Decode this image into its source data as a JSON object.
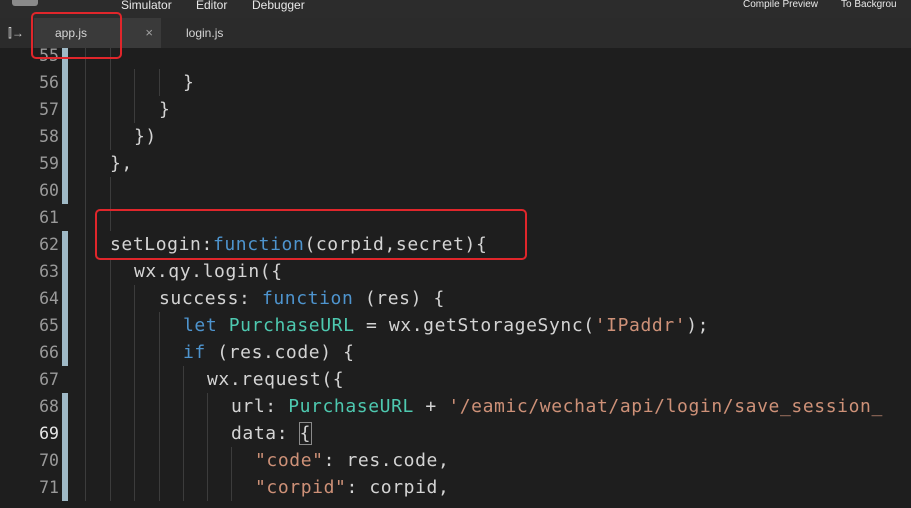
{
  "menubar": {
    "items": [
      "Simulator",
      "Editor",
      "Debugger"
    ],
    "right_items": [
      "Compile Preview",
      "To Backgrou"
    ]
  },
  "tabs": [
    {
      "label": "app.js",
      "close": "×",
      "active": true
    },
    {
      "label": "login.js",
      "active": false
    }
  ],
  "sidebar_toggle_icon": "⫿→",
  "colors": {
    "accent_highlight": "#e0262b",
    "keyword": "#4e94ce",
    "type": "#4ec9b0",
    "string": "#ce9178",
    "line_marker": "#9fb9c6"
  },
  "editor": {
    "current_line": 69,
    "lines": [
      {
        "num": "55",
        "segments": [
          {
            "t": ""
          }
        ]
      },
      {
        "num": "56",
        "segments": [
          {
            "t": "}"
          }
        ]
      },
      {
        "num": "57",
        "segments": [
          {
            "t": "}"
          }
        ]
      },
      {
        "num": "58",
        "segments": [
          {
            "t": "})"
          }
        ]
      },
      {
        "num": "59",
        "segments": [
          {
            "t": "},"
          }
        ]
      },
      {
        "num": "60",
        "segments": [
          {
            "t": ""
          }
        ]
      },
      {
        "num": "61",
        "segments": [
          {
            "t": ""
          }
        ]
      },
      {
        "num": "62",
        "segments": [
          {
            "t": "setLogin:"
          },
          {
            "t": "function",
            "c": "k-blue"
          },
          {
            "t": "(corpid,secret){"
          }
        ]
      },
      {
        "num": "63",
        "segments": [
          {
            "t": "wx.qy.login({"
          }
        ]
      },
      {
        "num": "64",
        "segments": [
          {
            "t": "success: "
          },
          {
            "t": "function",
            "c": "k-blue"
          },
          {
            "t": " (res) {"
          }
        ]
      },
      {
        "num": "65",
        "segments": [
          {
            "t": "let",
            "c": "k-blue"
          },
          {
            "t": " "
          },
          {
            "t": "PurchaseURL",
            "c": "k-teal"
          },
          {
            "t": " = wx.getStorageSync("
          },
          {
            "t": "'IPaddr'",
            "c": "k-str"
          },
          {
            "t": ");"
          }
        ]
      },
      {
        "num": "66",
        "segments": [
          {
            "t": "if",
            "c": "k-blue"
          },
          {
            "t": " (res.code) {"
          }
        ]
      },
      {
        "num": "67",
        "segments": [
          {
            "t": "wx.request({"
          }
        ]
      },
      {
        "num": "68",
        "segments": [
          {
            "t": "url: "
          },
          {
            "t": "PurchaseURL",
            "c": "k-teal"
          },
          {
            "t": " + "
          },
          {
            "t": "'/eamic/wechat/api/login/save_session_",
            "c": "k-str"
          }
        ]
      },
      {
        "num": "69",
        "segments": [
          {
            "t": "data: "
          },
          {
            "t": "{",
            "c": "brace-box"
          }
        ]
      },
      {
        "num": "70",
        "segments": [
          {
            "t": "\"code\"",
            "c": "k-str"
          },
          {
            "t": ": res.code,"
          }
        ]
      },
      {
        "num": "71",
        "segments": [
          {
            "t": "\"corpid\"",
            "c": "k-str"
          },
          {
            "t": ": corpid,"
          }
        ]
      }
    ]
  }
}
